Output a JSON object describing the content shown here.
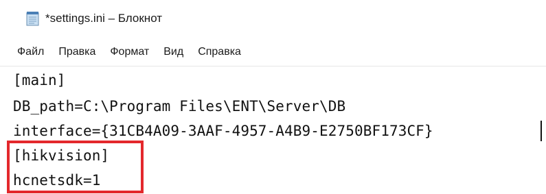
{
  "window": {
    "title": "*settings.ini – Блокнот",
    "icon": "notepad-icon"
  },
  "menu": {
    "items": [
      {
        "label": "Файл"
      },
      {
        "label": "Правка"
      },
      {
        "label": "Формат"
      },
      {
        "label": "Вид"
      },
      {
        "label": "Справка"
      }
    ]
  },
  "editor": {
    "lines": [
      "[main]",
      "DB_path=C:\\Program Files\\ENT\\Server\\DB",
      "interface={31CB4A09-3AAF-4957-A4B9-E2750BF173CF}",
      "[hikvision]",
      "hcnetsdk=1"
    ]
  },
  "annotation": {
    "highlight_color": "#e3282c"
  }
}
